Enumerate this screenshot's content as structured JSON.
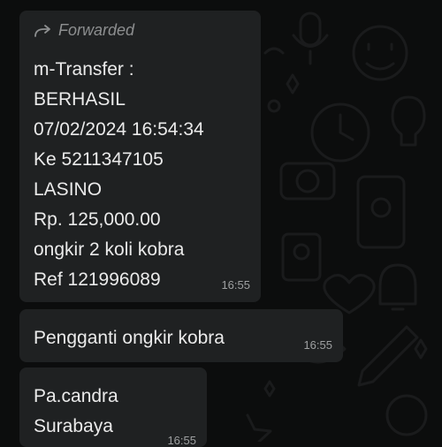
{
  "messages": [
    {
      "forwarded_label": "Forwarded",
      "lines": [
        "m-Transfer :",
        "BERHASIL",
        "07/02/2024 16:54:34",
        "Ke 5211347105",
        "LASINO",
        "Rp. 125,000.00",
        "ongkir 2 koli kobra",
        "Ref 121996089"
      ],
      "time": "16:55"
    },
    {
      "text": "Pengganti ongkir kobra",
      "time": "16:55"
    },
    {
      "lines": [
        "Pa.candra",
        "Surabaya"
      ],
      "time": "16:55"
    }
  ],
  "colors": {
    "background": "#0c0d0d",
    "bubble": "#1f2122",
    "text": "#eaeaea",
    "meta": "#8d8f90"
  },
  "icons": {
    "forward": "forward-arrow-icon"
  }
}
